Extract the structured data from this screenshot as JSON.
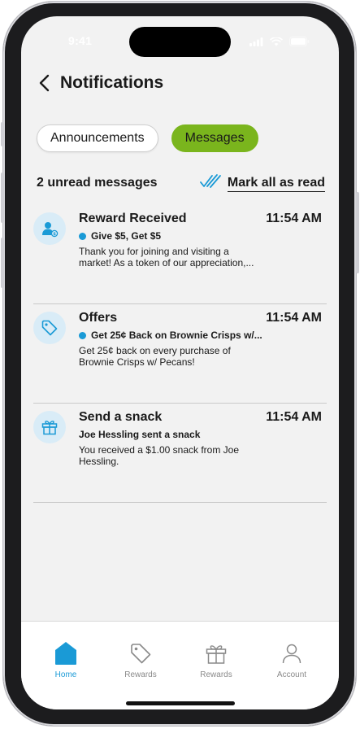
{
  "status_bar": {
    "time": "9:41"
  },
  "header": {
    "title": "Notifications"
  },
  "tabs": [
    {
      "label": "Announcements",
      "active": false
    },
    {
      "label": "Messages",
      "active": true
    }
  ],
  "summary": {
    "unread_text": "2 unread messages",
    "mark_all_label": "Mark all as read"
  },
  "messages": [
    {
      "icon": "user-reward-icon",
      "title": "Reward Received",
      "time": "11:54 AM",
      "unread": true,
      "subtitle": "Give $5, Get $5",
      "body": "Thank you for joining and visiting a market! As a token of our appreciation,..."
    },
    {
      "icon": "tag-icon",
      "title": "Offers",
      "time": "11:54 AM",
      "unread": true,
      "subtitle": "Get 25¢ Back on Brownie Crisps w/...",
      "body": "Get 25¢ back on every purchase of Brownie Crisps w/ Pecans!"
    },
    {
      "icon": "gift-icon",
      "title": "Send a snack",
      "time": "11:54 AM",
      "unread": false,
      "subtitle": "Joe Hessling sent a snack",
      "body": "You received a $1.00 snack from Joe Hessling."
    }
  ],
  "bottom_nav": [
    {
      "label": "Home",
      "icon": "home-icon",
      "active": true
    },
    {
      "label": "Rewards",
      "icon": "tag-icon",
      "active": false
    },
    {
      "label": "Rewards",
      "icon": "gift-icon",
      "active": false
    },
    {
      "label": "Account",
      "icon": "user-icon",
      "active": false
    }
  ],
  "colors": {
    "accent": "#1a9ad6",
    "active_tab": "#7ab51d",
    "icon_bg": "#d9ecf7"
  }
}
